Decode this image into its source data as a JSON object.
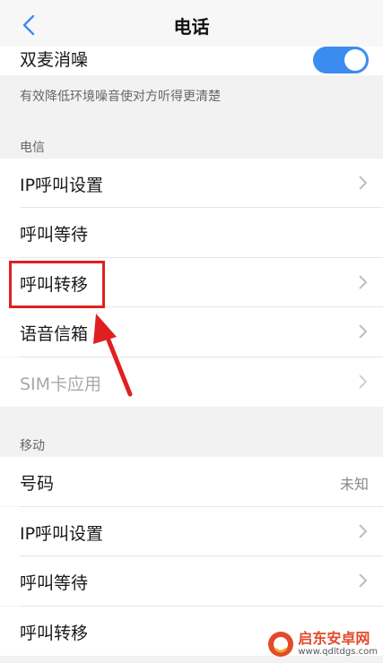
{
  "header": {
    "title": "电话",
    "back_icon": "chevron-left-icon"
  },
  "noise_cancel": {
    "label": "双麦消噪",
    "enabled": true,
    "description": "有效降低环境噪音使对方听得更清楚"
  },
  "sections": [
    {
      "title": "电信",
      "items": [
        {
          "label": "IP呼叫设置",
          "chevron": true,
          "disabled": false
        },
        {
          "label": "呼叫等待",
          "chevron": false,
          "disabled": false
        },
        {
          "label": "呼叫转移",
          "chevron": true,
          "disabled": false
        },
        {
          "label": "语音信箱",
          "chevron": true,
          "disabled": false
        },
        {
          "label": "SIM卡应用",
          "chevron": true,
          "disabled": true
        }
      ]
    },
    {
      "title": "移动",
      "items": [
        {
          "label": "号码",
          "value": "未知"
        },
        {
          "label": "IP呼叫设置",
          "chevron": true
        },
        {
          "label": "呼叫等待",
          "chevron": true
        },
        {
          "label": "呼叫转移",
          "chevron": false
        }
      ]
    }
  ],
  "colors": {
    "accent": "#3c8cf0",
    "annotation": "#e02020"
  },
  "watermark": {
    "title": "启东安卓网",
    "url": "www.qdltdgs.com"
  }
}
